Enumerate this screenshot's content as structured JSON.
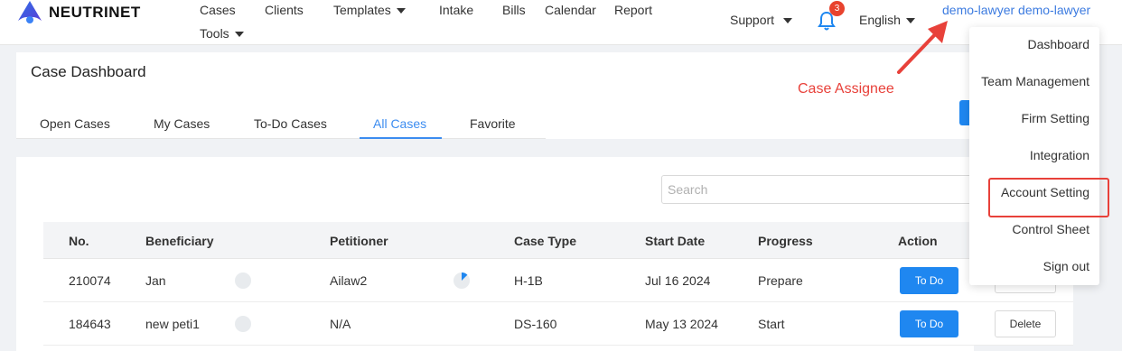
{
  "app": {
    "brand": "NEUTRINET"
  },
  "nav": {
    "items": [
      "Cases",
      "Clients",
      "Templates",
      "Intake",
      "Bills",
      "Calendar",
      "Report",
      "Tools"
    ],
    "support": "Support",
    "notifications_count": "3",
    "language": "English",
    "user": "demo-lawyer demo-lawyer"
  },
  "dashboard": {
    "title": "Case Dashboard",
    "tabs": [
      "Open Cases",
      "My Cases",
      "To-Do Cases",
      "All Cases",
      "Favorite"
    ],
    "active_tab": "All Cases",
    "search_placeholder": "Search"
  },
  "table": {
    "columns": [
      "No.",
      "Beneficiary",
      "Petitioner",
      "Case Type",
      "Start Date",
      "Progress",
      "Action"
    ],
    "rows": [
      {
        "no": "210074",
        "beneficiary": "Jan",
        "petitioner": "Ailaw2",
        "case_type": "H-1B",
        "start_date": "Jul 16 2024",
        "progress": "Prepare",
        "action": "To Do"
      },
      {
        "no": "184643",
        "beneficiary": "new peti1",
        "petitioner": "N/A",
        "case_type": "DS-160",
        "start_date": "May 13 2024",
        "progress": "Start",
        "action": "To Do",
        "delete": "Delete"
      }
    ]
  },
  "annotation": {
    "label": "Case Assignee",
    "color": "#e8413a"
  },
  "user_menu": {
    "items": [
      "Dashboard",
      "Team Management",
      "Firm Setting",
      "Integration",
      "Account Setting",
      "Control Sheet",
      "Sign out"
    ],
    "highlighted": "Account Setting"
  },
  "colors": {
    "accent": "#1f87f0",
    "link": "#3c7be0",
    "annotation": "#e8413a"
  }
}
